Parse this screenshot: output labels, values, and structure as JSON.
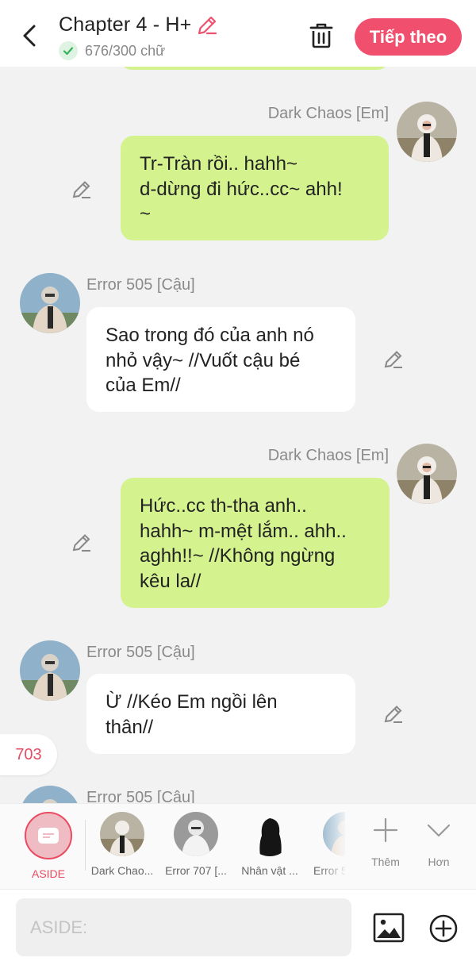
{
  "header": {
    "title": "Chapter 4 - H+",
    "word_count": "676/300 chữ",
    "next_label": "Tiếp theo"
  },
  "messages": [
    {
      "sender": "Dark Chaos [Em]",
      "side": "right",
      "lines": [
        "Tr-Tràn rồi.. hahh~",
        "d-dừng đi hức..cc~ ahh!",
        "~"
      ]
    },
    {
      "sender": "Error 505 [Cậu]",
      "side": "left",
      "lines": [
        "Sao trong đó của anh nó",
        "nhỏ vậy~ //Vuốt cậu bé",
        "của Em//"
      ]
    },
    {
      "sender": "Dark Chaos [Em]",
      "side": "right",
      "lines": [
        "Hức..cc th-tha anh..",
        "hahh~ m-mệt lắm.. ahh..",
        "aghh!!~ //Không ngừng",
        "kêu la//"
      ]
    },
    {
      "sender": "Error 505 [Cậu]",
      "side": "left",
      "lines": [
        "Ừ //Kéo Em ngồi lên",
        "thân//"
      ]
    },
    {
      "sender": "Error 505 [Cậu]",
      "side": "left",
      "lines": []
    }
  ],
  "badge_count": "703",
  "characters": {
    "aside_label": "ASIDE",
    "items": [
      {
        "label": "Dark Chao..."
      },
      {
        "label": "Error 707 [..."
      },
      {
        "label": "Nhân vật ..."
      },
      {
        "label": "Error 5"
      }
    ],
    "add_label": "Thêm",
    "more_label": "Hơn"
  },
  "input": {
    "placeholder": "ASIDE:"
  },
  "colors": {
    "accent": "#f0506e",
    "right_bubble": "#d4f38e",
    "left_bubble": "#ffffff",
    "background": "#f2f2f2"
  }
}
